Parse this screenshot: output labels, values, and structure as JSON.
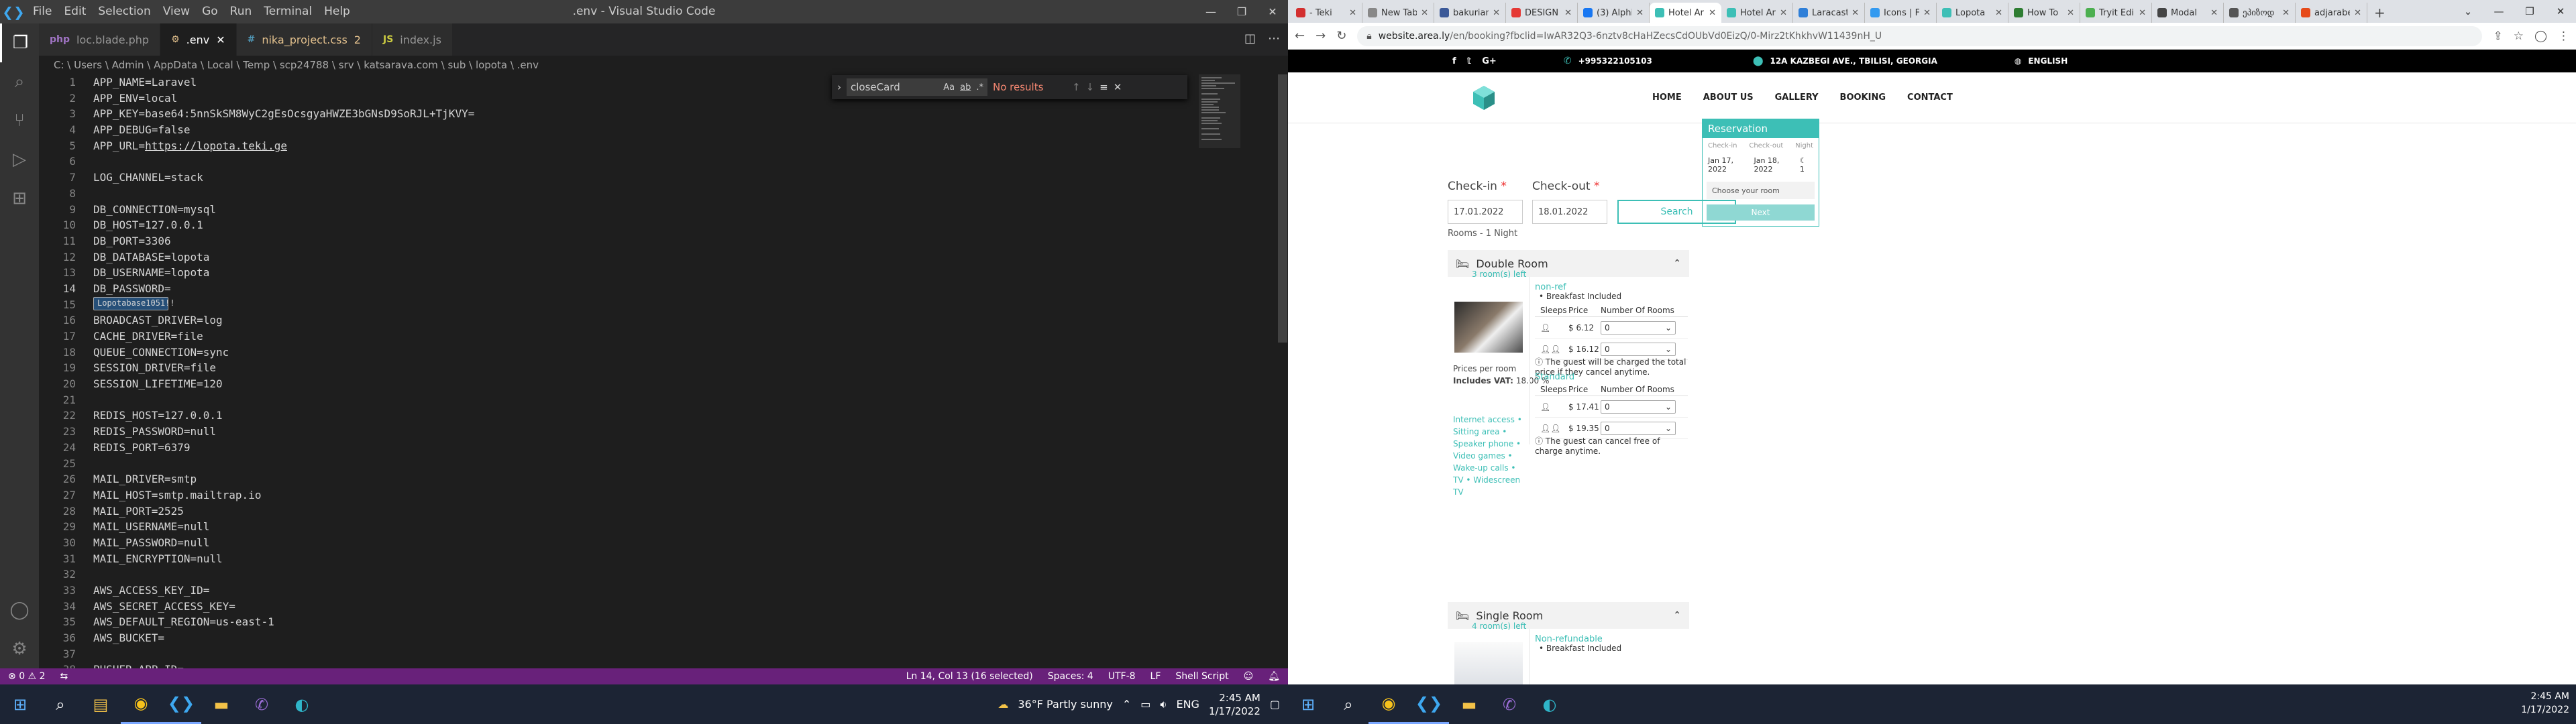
{
  "vscode": {
    "menu": [
      "File",
      "Edit",
      "Selection",
      "View",
      "Go",
      "Run",
      "Terminal",
      "Help"
    ],
    "window_title": ".env - Visual Studio Code",
    "tabs": [
      {
        "label": "loc.blade.php",
        "icon": "php-file-icon",
        "active": false,
        "modified": false
      },
      {
        "label": ".env",
        "icon": "env-file-icon",
        "active": true,
        "modified": false
      },
      {
        "label": "nika_project.css",
        "suffix": "2",
        "icon": "css-file-icon",
        "active": false,
        "modified": true
      },
      {
        "label": "index.js",
        "icon": "js-file-icon",
        "active": false,
        "modified": false
      }
    ],
    "breadcrumb": "C: \\ Users \\ Admin \\ AppData \\ Local \\ Temp \\ scp24788 \\ srv \\ katsarava.com \\ sub \\ lopota \\ .env",
    "code": [
      {
        "n": "1",
        "t": "APP_NAME=Laravel"
      },
      {
        "n": "2",
        "t": "APP_ENV=local"
      },
      {
        "n": "3",
        "t": "APP_KEY=base64:5nnSkSM8WyC2gEsOcsgyaHWZE3bGNsD9SoRJL+TjKVY="
      },
      {
        "n": "4",
        "t": "APP_DEBUG=false"
      },
      {
        "n": "5",
        "t": "APP_URL=",
        "link": "https://lopota.teki.ge"
      },
      {
        "n": "6",
        "t": ""
      },
      {
        "n": "7",
        "t": "LOG_CHANNEL=stack"
      },
      {
        "n": "8",
        "t": ""
      },
      {
        "n": "9",
        "t": "DB_CONNECTION=mysql"
      },
      {
        "n": "10",
        "t": "DB_HOST=127.0.0.1"
      },
      {
        "n": "11",
        "t": "DB_PORT=3306"
      },
      {
        "n": "12",
        "t": "DB_DATABASE=lopota"
      },
      {
        "n": "13",
        "t": "DB_USERNAME=lopota"
      },
      {
        "n": "14",
        "t": "DB_PASSWORD=",
        "sel": "Lopotabase1051!!"
      },
      {
        "n": "15",
        "t": ""
      },
      {
        "n": "16",
        "t": "BROADCAST_DRIVER=log"
      },
      {
        "n": "17",
        "t": "CACHE_DRIVER=file"
      },
      {
        "n": "18",
        "t": "QUEUE_CONNECTION=sync"
      },
      {
        "n": "19",
        "t": "SESSION_DRIVER=file"
      },
      {
        "n": "20",
        "t": "SESSION_LIFETIME=120"
      },
      {
        "n": "21",
        "t": ""
      },
      {
        "n": "22",
        "t": "REDIS_HOST=127.0.0.1"
      },
      {
        "n": "23",
        "t": "REDIS_PASSWORD=null"
      },
      {
        "n": "24",
        "t": "REDIS_PORT=6379"
      },
      {
        "n": "25",
        "t": ""
      },
      {
        "n": "26",
        "t": "MAIL_DRIVER=smtp"
      },
      {
        "n": "27",
        "t": "MAIL_HOST=smtp.mailtrap.io"
      },
      {
        "n": "28",
        "t": "MAIL_PORT=2525"
      },
      {
        "n": "29",
        "t": "MAIL_USERNAME=null"
      },
      {
        "n": "30",
        "t": "MAIL_PASSWORD=null"
      },
      {
        "n": "31",
        "t": "MAIL_ENCRYPTION=null"
      },
      {
        "n": "32",
        "t": ""
      },
      {
        "n": "33",
        "t": "AWS_ACCESS_KEY_ID="
      },
      {
        "n": "34",
        "t": "AWS_SECRET_ACCESS_KEY="
      },
      {
        "n": "35",
        "t": "AWS_DEFAULT_REGION=us-east-1"
      },
      {
        "n": "36",
        "t": "AWS_BUCKET="
      },
      {
        "n": "37",
        "t": ""
      },
      {
        "n": "38",
        "t": "PUSHER_APP_ID="
      }
    ],
    "current_line": "14",
    "find": {
      "query": "closeCard",
      "opt_case": "Aa",
      "opt_word": "ab",
      "opt_regex": ".*",
      "result": "No results"
    },
    "status": {
      "errors": "0",
      "warnings": "2",
      "position": "Ln 14, Col 13 (16 selected)",
      "spaces": "Spaces: 4",
      "encoding": "UTF-8",
      "eol": "LF",
      "language": "Shell Script"
    }
  },
  "taskbar_left": {
    "weather": "36°F  Partly sunny",
    "lang": "ENG",
    "time": "2:45 AM",
    "date": "1/17/2022"
  },
  "browser": {
    "tabs": [
      {
        "label": "- Teki",
        "color": "#d32f2f",
        "active": false
      },
      {
        "label": "New Tab",
        "color": "#888888",
        "active": false
      },
      {
        "label": "bakuriani",
        "color": "#3b5998",
        "active": false
      },
      {
        "label": "DESIGN",
        "color": "#e53935",
        "active": false
      },
      {
        "label": "(3) Alphi",
        "color": "#1877f2",
        "active": false
      },
      {
        "label": "Hotel Ar",
        "color": "#3dbfb6",
        "active": true
      },
      {
        "label": "Hotel Ar",
        "color": "#3dbfb6",
        "active": false
      },
      {
        "label": "Laracast",
        "color": "#2f7fd8",
        "active": false
      },
      {
        "label": "Icons | F",
        "color": "#339af0",
        "active": false
      },
      {
        "label": "Lopota",
        "color": "#3dbfb6",
        "active": false
      },
      {
        "label": "How To",
        "color": "#2e7d32",
        "active": false
      },
      {
        "label": "Tryit Edi",
        "color": "#4caf50",
        "active": false
      },
      {
        "label": "Modal",
        "color": "#444444",
        "active": false
      },
      {
        "label": "ეპიზოდ",
        "color": "#555555",
        "active": false
      },
      {
        "label": "adjarabet",
        "color": "#e64a19",
        "active": false
      }
    ],
    "url_host": "website.area.ly",
    "url_path": "/en/booking?fbclid=IwAR32Q3-6nztv8cHaHZecsCdOUbVd0EizQ/0-Mirz2tKhkhvW11439nH_U"
  },
  "site": {
    "phone": "+995322105103",
    "address": "12A KAZBEGI AVE., TBILISI, GEORGIA",
    "language": "ENGLISH",
    "nav": [
      "HOME",
      "ABOUT US",
      "GALLERY",
      "BOOKING",
      "CONTACT"
    ],
    "checkin_label": "Check-in",
    "checkout_label": "Check-out",
    "req_mark": "*",
    "checkin_value": "17.01.2022",
    "checkout_value": "18.01.2022",
    "search": "Search",
    "rooms_title": "Rooms - 1 Night",
    "rooms": [
      {
        "name": "Double Room",
        "left": "3 room(s) left",
        "prices_per_room": "Prices per room",
        "includes_vat_label": "Includes VAT:",
        "vat": "18.00 %",
        "amenities": "Internet access • Sitting area • Speaker phone • Video games • Wake-up calls • TV • Widescreen TV",
        "rates": [
          {
            "title": "non-ref",
            "bullet": "Breakfast Included",
            "head": [
              "Sleeps",
              "Price",
              "Number Of Rooms"
            ],
            "rows": [
              {
                "price": "$ 6.12",
                "value": "0"
              },
              {
                "price": "$ 16.12",
                "value": "0"
              }
            ],
            "note": "The guest will be charged the total price if they cancel anytime."
          },
          {
            "title": "Standard",
            "bullet": "",
            "head": [
              "Sleeps",
              "Price",
              "Number Of Rooms"
            ],
            "rows": [
              {
                "price": "$ 17.41",
                "value": "0"
              },
              {
                "price": "$ 19.35",
                "value": "0"
              }
            ],
            "note": "The guest can cancel free of charge anytime."
          }
        ]
      },
      {
        "name": "Single Room",
        "left": "4 room(s) left",
        "rate_title": "Non-refundable",
        "bullet": "Breakfast Included"
      }
    ],
    "reservation": {
      "title": "Reservation",
      "col_in": "Check-in",
      "col_out": "Check-out",
      "col_night": "Night",
      "in": "Jan 17, 2022",
      "out": "Jan 18, 2022",
      "nights": "1",
      "choose": "Choose your room",
      "next": "Next"
    }
  },
  "taskbar_right": {
    "time": "2:45 AM",
    "date": "1/17/2022"
  }
}
